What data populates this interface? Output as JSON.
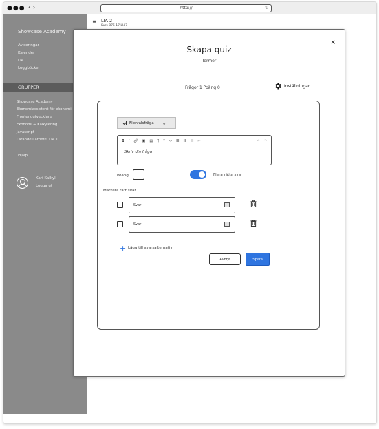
{
  "browser": {
    "window_dots": "●●●",
    "nav_arrows": "‹ ›",
    "url": "http://"
  },
  "sidebar": {
    "title": "Showcase Academy",
    "links": [
      "Aviseringar",
      "Kalender",
      "LIA",
      "Loggböcker"
    ],
    "groups_header": "GRUPPER",
    "groups": [
      "Showcase Academy",
      "Ekonomiassistent för ekonomi",
      "Frontendutvecklare",
      "Ekonomi & Kalkylering",
      "Javascript",
      "Lärande i arbete, LIA 1"
    ],
    "help": "Hjälp",
    "user_name": "Kari Kalkyl",
    "logout": "Logga ut"
  },
  "header": {
    "course_title": "LIA 2",
    "course_subtitle": "Kurs 876 17 LI47"
  },
  "modal": {
    "title": "Skapa quiz",
    "subtitle": "Termer",
    "meta": "Frågor 1  Poäng 0",
    "settings_label": "Inställningar",
    "close_glyph": "×",
    "question": {
      "type_label": "Flervalsfråga",
      "editor_placeholder": "Skriv din fråga",
      "points_label": "Poäng",
      "multiple_correct_label": "Flera rätta svar",
      "multiple_correct_enabled": true,
      "mark_correct_label": "Markera rätt svar",
      "answers": [
        {
          "placeholder": "Svar",
          "checked": false
        },
        {
          "placeholder": "Svar",
          "checked": false
        }
      ],
      "add_option_label": "Lägg till svarsalternativ",
      "cancel_label": "Avbryt",
      "save_label": "Spara"
    }
  },
  "colors": {
    "sidebar_bg": "#8a8a8a",
    "groups_bar_bg": "#5c5c5c",
    "accent": "#2f75e0"
  },
  "icons": [
    "hamburger-icon",
    "close-icon",
    "gear-icon",
    "checkbox-icon",
    "chevron-down-icon",
    "image-icon",
    "trash-icon",
    "plus-icon",
    "avatar-icon"
  ]
}
